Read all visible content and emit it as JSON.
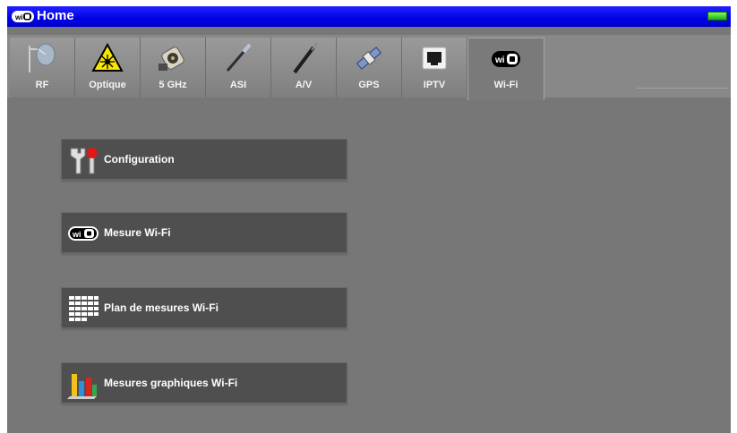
{
  "titlebar": {
    "title": "Home",
    "logo_icon": "wifi-badge-icon",
    "status_icon": "battery-icon",
    "battery_color": "#2fd12f"
  },
  "tabs": [
    {
      "id": "rf",
      "label": "RF",
      "icon": "satellite-dish-icon"
    },
    {
      "id": "optique",
      "label": "Optique",
      "icon": "laser-warning-icon"
    },
    {
      "id": "5ghz",
      "label": "5 GHz",
      "icon": "rf-connector-icon"
    },
    {
      "id": "asi",
      "label": "ASI",
      "icon": "asi-cable-icon"
    },
    {
      "id": "av",
      "label": "A/V",
      "icon": "av-cable-icon"
    },
    {
      "id": "gps",
      "label": "GPS",
      "icon": "gps-satellite-icon"
    },
    {
      "id": "iptv",
      "label": "IPTV",
      "icon": "ethernet-port-icon"
    },
    {
      "id": "wifi",
      "label": "Wi-Fi",
      "icon": "wifi-badge-icon",
      "active": true
    }
  ],
  "menu": [
    {
      "label": "Configuration",
      "icon": "tools-icon"
    },
    {
      "label": "Mesure Wi-Fi",
      "icon": "wifi-badge-icon"
    },
    {
      "label": "Plan de mesures Wi-Fi",
      "icon": "measurement-plan-grid-icon"
    },
    {
      "label": "Mesures graphiques Wi-Fi",
      "icon": "bar-graph-icon"
    }
  ],
  "colors": {
    "titlebar": "#0000e6",
    "background": "#777777",
    "button": "#4f4f4f",
    "text": "#ffffff"
  }
}
